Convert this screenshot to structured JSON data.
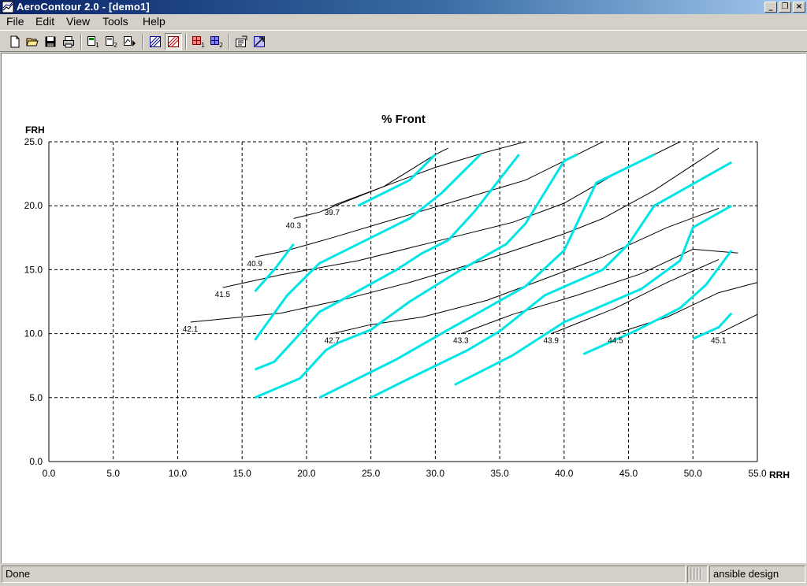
{
  "window": {
    "title": "AeroContour 2.0 - [demo1]",
    "controls": {
      "minimize": "_",
      "restore": "❐",
      "close": "×"
    }
  },
  "menu": [
    "File",
    "Edit",
    "View",
    "Tools",
    "Help"
  ],
  "toolbar": {
    "buttons": [
      {
        "name": "new-file-icon"
      },
      {
        "name": "open-folder-icon"
      },
      {
        "name": "save-icon"
      },
      {
        "name": "print-icon"
      },
      {
        "name": "chart-1-icon"
      },
      {
        "name": "chart-2-icon"
      },
      {
        "name": "chart-3-icon"
      },
      {
        "name": "contour-view-a-icon"
      },
      {
        "name": "contour-view-b-icon",
        "pressed": true
      },
      {
        "name": "grid-1-icon"
      },
      {
        "name": "grid-2-icon"
      },
      {
        "name": "properties-icon"
      },
      {
        "name": "tools-icon"
      }
    ]
  },
  "status": {
    "left": "Done",
    "right": "ansible design"
  },
  "colors": {
    "black_contour": "#000000",
    "cyan_contour": "#00e5e5",
    "grid": "#000000"
  },
  "chart_data": {
    "type": "contour",
    "title": "% Front",
    "xlabel": "RRH",
    "ylabel": "FRH",
    "xlim": [
      0,
      55
    ],
    "ylim": [
      0,
      25
    ],
    "xticks": [
      "0.0",
      "5.0",
      "10.0",
      "15.0",
      "20.0",
      "25.0",
      "30.0",
      "35.0",
      "40.0",
      "45.0",
      "50.0",
      "55.0"
    ],
    "yticks": [
      "0.0",
      "5.0",
      "10.0",
      "15.0",
      "20.0",
      "25.0"
    ],
    "grid": true,
    "contour_lines": [
      {
        "label": "39.7",
        "points": [
          [
            22.0,
            20.0
          ],
          [
            26.0,
            21.5
          ],
          [
            30.0,
            24.0
          ],
          [
            31.0,
            24.5
          ]
        ]
      },
      {
        "label": "40.3",
        "points": [
          [
            19.0,
            19.0
          ],
          [
            21.0,
            19.5
          ],
          [
            26.0,
            21.5
          ],
          [
            30.0,
            23.0
          ],
          [
            34.0,
            24.2
          ],
          [
            37.0,
            25.0
          ]
        ]
      },
      {
        "label": "40.9",
        "points": [
          [
            16.0,
            16.0
          ],
          [
            18.5,
            16.5
          ],
          [
            22.0,
            17.5
          ],
          [
            27.0,
            19.0
          ],
          [
            32.0,
            20.5
          ],
          [
            37.0,
            22.0
          ],
          [
            40.0,
            23.5
          ],
          [
            43.0,
            25.0
          ]
        ]
      },
      {
        "label": "41.5",
        "points": [
          [
            13.5,
            13.6
          ],
          [
            18.0,
            14.6
          ],
          [
            24.0,
            15.7
          ],
          [
            30.0,
            17.2
          ],
          [
            36.0,
            18.7
          ],
          [
            40.0,
            20.2
          ],
          [
            44.0,
            22.5
          ],
          [
            49.0,
            25.0
          ]
        ]
      },
      {
        "label": "42.1",
        "points": [
          [
            11.0,
            10.9
          ],
          [
            14.0,
            11.2
          ],
          [
            18.0,
            11.6
          ],
          [
            23.0,
            12.7
          ],
          [
            28.0,
            14.0
          ],
          [
            34.0,
            15.8
          ],
          [
            40.0,
            17.8
          ],
          [
            43.0,
            19.0
          ],
          [
            47.0,
            21.2
          ],
          [
            52.0,
            24.5
          ]
        ]
      },
      {
        "label": "42.7",
        "points": [
          [
            22.0,
            10.0
          ],
          [
            25.0,
            10.7
          ],
          [
            29.0,
            11.3
          ],
          [
            34.0,
            12.6
          ],
          [
            38.0,
            14.1
          ],
          [
            43.0,
            16.0
          ],
          [
            48.0,
            18.3
          ],
          [
            52.0,
            19.8
          ]
        ]
      },
      {
        "label": "43.3",
        "points": [
          [
            32.0,
            10.0
          ],
          [
            36.0,
            11.5
          ],
          [
            41.0,
            13.0
          ],
          [
            46.0,
            14.7
          ],
          [
            50.0,
            16.6
          ],
          [
            53.5,
            16.3
          ]
        ]
      },
      {
        "label": "43.9",
        "points": [
          [
            39.0,
            10.0
          ],
          [
            44.0,
            12.0
          ],
          [
            48.0,
            14.0
          ],
          [
            52.0,
            15.8
          ]
        ]
      },
      {
        "label": "44.5",
        "points": [
          [
            44.0,
            10.0
          ],
          [
            48.0,
            11.3
          ],
          [
            52.0,
            13.2
          ],
          [
            55.0,
            14.0
          ]
        ]
      },
      {
        "label": "45.1",
        "points": [
          [
            52.0,
            10.0
          ],
          [
            55.0,
            11.5
          ]
        ]
      }
    ],
    "cyan_lines": [
      [
        [
          24.0,
          20.0
        ],
        [
          28.0,
          22.0
        ],
        [
          30.0,
          24.0
        ]
      ],
      [
        [
          16.0,
          17.0
        ],
        [
          16.0,
          17.0
        ]
      ],
      [
        [
          16.0,
          13.3
        ],
        [
          17.5,
          15.0
        ],
        [
          19.0,
          17.0
        ]
      ],
      [
        [
          16.0,
          9.5
        ],
        [
          18.5,
          13.0
        ],
        [
          21.0,
          15.5
        ],
        [
          25.0,
          17.5
        ],
        [
          28.0,
          19.0
        ],
        [
          30.5,
          21.0
        ],
        [
          33.5,
          24.0
        ]
      ],
      [
        [
          16.0,
          7.2
        ],
        [
          17.5,
          7.8
        ],
        [
          19.5,
          10.0
        ],
        [
          21.0,
          11.7
        ],
        [
          22.5,
          12.5
        ],
        [
          27.0,
          15.0
        ],
        [
          29.0,
          16.3
        ],
        [
          31.0,
          17.3
        ],
        [
          33.0,
          19.5
        ],
        [
          36.5,
          24.0
        ]
      ],
      [
        [
          16.0,
          5.0
        ],
        [
          19.5,
          6.5
        ],
        [
          21.5,
          8.7
        ],
        [
          22.5,
          9.3
        ],
        [
          25.0,
          10.3
        ],
        [
          28.0,
          12.5
        ],
        [
          32.0,
          15.0
        ],
        [
          35.5,
          17.0
        ],
        [
          37.0,
          18.6
        ],
        [
          40.0,
          23.5
        ],
        [
          41.0,
          24.0
        ]
      ],
      [
        [
          21.0,
          5.0
        ],
        [
          27.0,
          8.0
        ],
        [
          31.0,
          10.3
        ],
        [
          37.0,
          13.7
        ],
        [
          40.0,
          16.5
        ],
        [
          42.5,
          21.8
        ],
        [
          47.0,
          24.0
        ]
      ],
      [
        [
          25.0,
          5.0
        ],
        [
          28.0,
          6.5
        ],
        [
          32.5,
          8.7
        ],
        [
          35.0,
          10.2
        ],
        [
          38.5,
          13.0
        ],
        [
          43.0,
          15.0
        ],
        [
          45.0,
          17.0
        ],
        [
          47.0,
          20.0
        ],
        [
          53.0,
          23.4
        ]
      ],
      [
        [
          31.5,
          6.0
        ],
        [
          36.0,
          8.3
        ],
        [
          40.0,
          10.9
        ],
        [
          46.0,
          13.5
        ],
        [
          49.0,
          15.7
        ],
        [
          50.0,
          18.3
        ],
        [
          53.0,
          20.0
        ]
      ],
      [
        [
          41.5,
          8.4
        ],
        [
          45.5,
          10.2
        ],
        [
          49.0,
          12.0
        ],
        [
          51.0,
          13.8
        ],
        [
          53.0,
          16.5
        ]
      ],
      [
        [
          50.0,
          9.6
        ],
        [
          52.0,
          10.5
        ],
        [
          53.0,
          11.6
        ]
      ]
    ]
  }
}
